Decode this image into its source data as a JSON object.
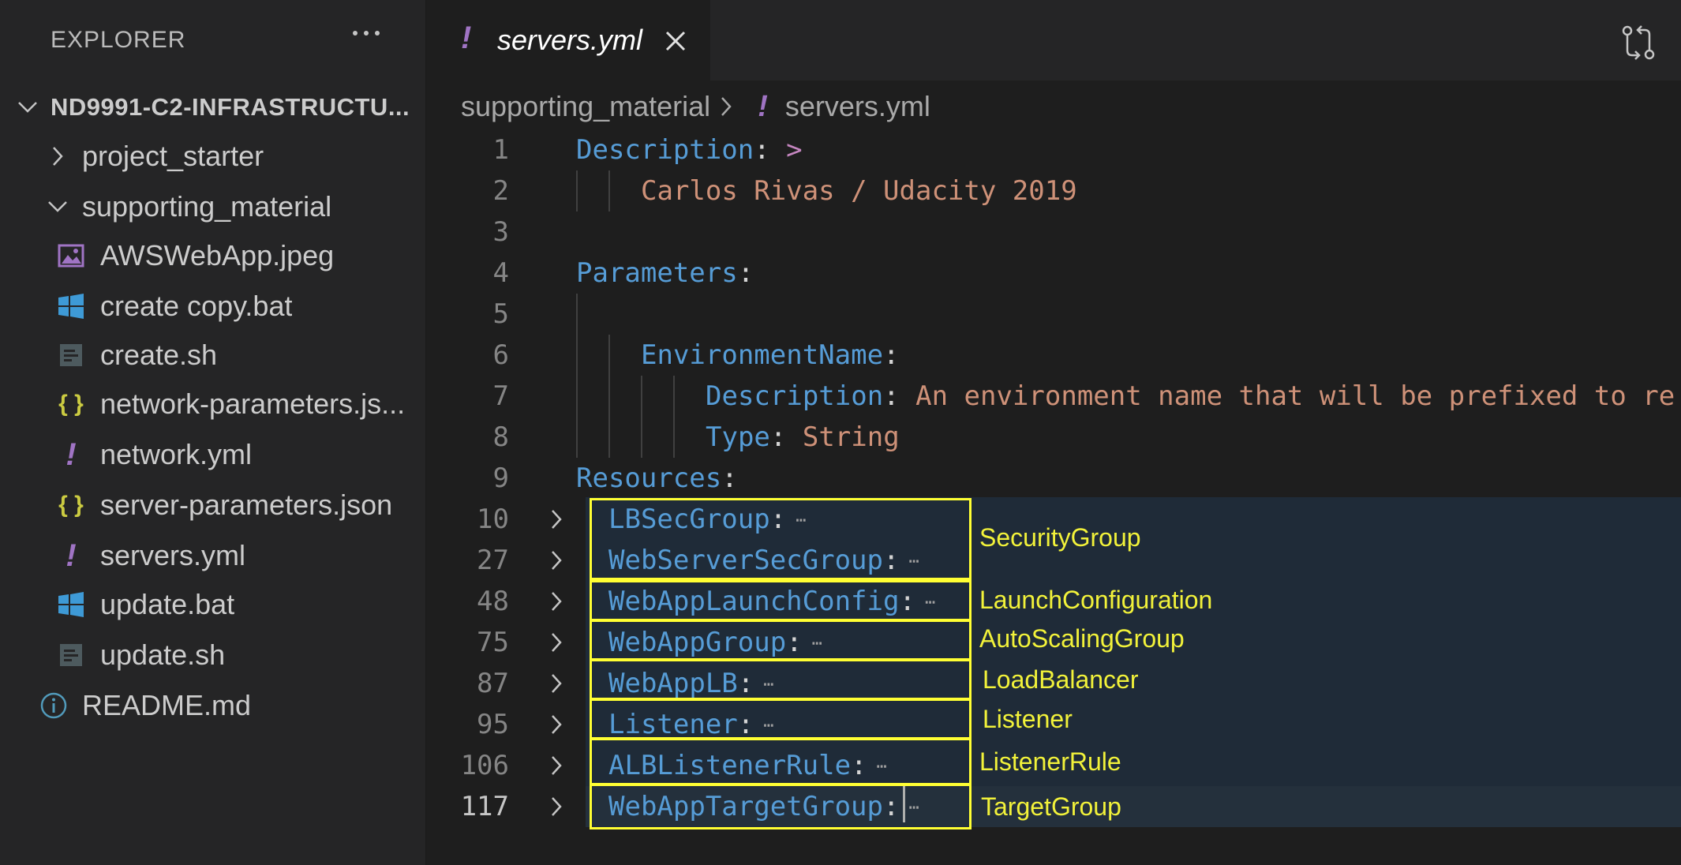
{
  "sidebar": {
    "title": "EXPLORER",
    "root": "ND9991-C2-INFRASTRUCTU...",
    "items": [
      {
        "label": "project_starter",
        "kind": "folder-collapsed"
      },
      {
        "label": "supporting_material",
        "kind": "folder-expanded"
      },
      {
        "label": "AWSWebApp.jpeg",
        "kind": "image"
      },
      {
        "label": "create copy.bat",
        "kind": "windows"
      },
      {
        "label": "create.sh",
        "kind": "shell"
      },
      {
        "label": "network-parameters.js...",
        "kind": "json"
      },
      {
        "label": "network.yml",
        "kind": "yaml"
      },
      {
        "label": "server-parameters.json",
        "kind": "json"
      },
      {
        "label": "servers.yml",
        "kind": "yaml"
      },
      {
        "label": "update.bat",
        "kind": "windows"
      },
      {
        "label": "update.sh",
        "kind": "shell"
      },
      {
        "label": "README.md",
        "kind": "info"
      }
    ]
  },
  "tab": {
    "glyph": "!",
    "name": "servers.yml"
  },
  "breadcrumb": {
    "folder": "supporting_material",
    "glyph": "!",
    "file": "servers.yml"
  },
  "editor": {
    "lines": [
      {
        "n": "1",
        "key": "Description",
        "colon": ":",
        "op": " >"
      },
      {
        "n": "2",
        "str": "Carlos Rivas / Udacity 2019"
      },
      {
        "n": "3"
      },
      {
        "n": "4",
        "key": "Parameters",
        "colon": ":"
      },
      {
        "n": "5"
      },
      {
        "n": "6",
        "key": "EnvironmentName",
        "colon": ":"
      },
      {
        "n": "7",
        "key": "Description",
        "colon": ": ",
        "str": "An environment name that will be prefixed to re"
      },
      {
        "n": "8",
        "key": "Type",
        "colon": ": ",
        "str": "String"
      },
      {
        "n": "9",
        "key": "Resources",
        "colon": ":"
      },
      {
        "n": "10",
        "key": "LBSecGroup",
        "colon": ":",
        "ellipsis": "⋯"
      },
      {
        "n": "27",
        "key": "WebServerSecGroup",
        "colon": ":",
        "ellipsis": "⋯"
      },
      {
        "n": "48",
        "key": "WebAppLaunchConfig",
        "colon": ":",
        "ellipsis": "⋯"
      },
      {
        "n": "75",
        "key": "WebAppGroup",
        "colon": ":",
        "ellipsis": "⋯"
      },
      {
        "n": "87",
        "key": "WebAppLB",
        "colon": ":",
        "ellipsis": "⋯"
      },
      {
        "n": "95",
        "key": "Listener",
        "colon": ":",
        "ellipsis": "⋯"
      },
      {
        "n": "106",
        "key": "ALBListenerRule",
        "colon": ":",
        "ellipsis": "⋯"
      },
      {
        "n": "117",
        "key": "WebAppTargetGroup",
        "colon": ":",
        "ellipsis": "⋯"
      }
    ]
  },
  "annotations": {
    "security_group": "SecurityGroup",
    "launch_configuration": "LaunchConfiguration",
    "autoscaling_group": "AutoScalingGroup",
    "load_balancer": "LoadBalancer",
    "listener": "Listener",
    "listener_rule": "ListenerRule",
    "target_group": "TargetGroup"
  },
  "colors": {
    "key": "#569cd6",
    "string": "#ce9178",
    "operator": "#c586c0",
    "yaml_icon": "#a074c4",
    "json_icon": "#cbcb41",
    "windows_icon": "#3e9ad6",
    "annotation": "#ffff33"
  }
}
